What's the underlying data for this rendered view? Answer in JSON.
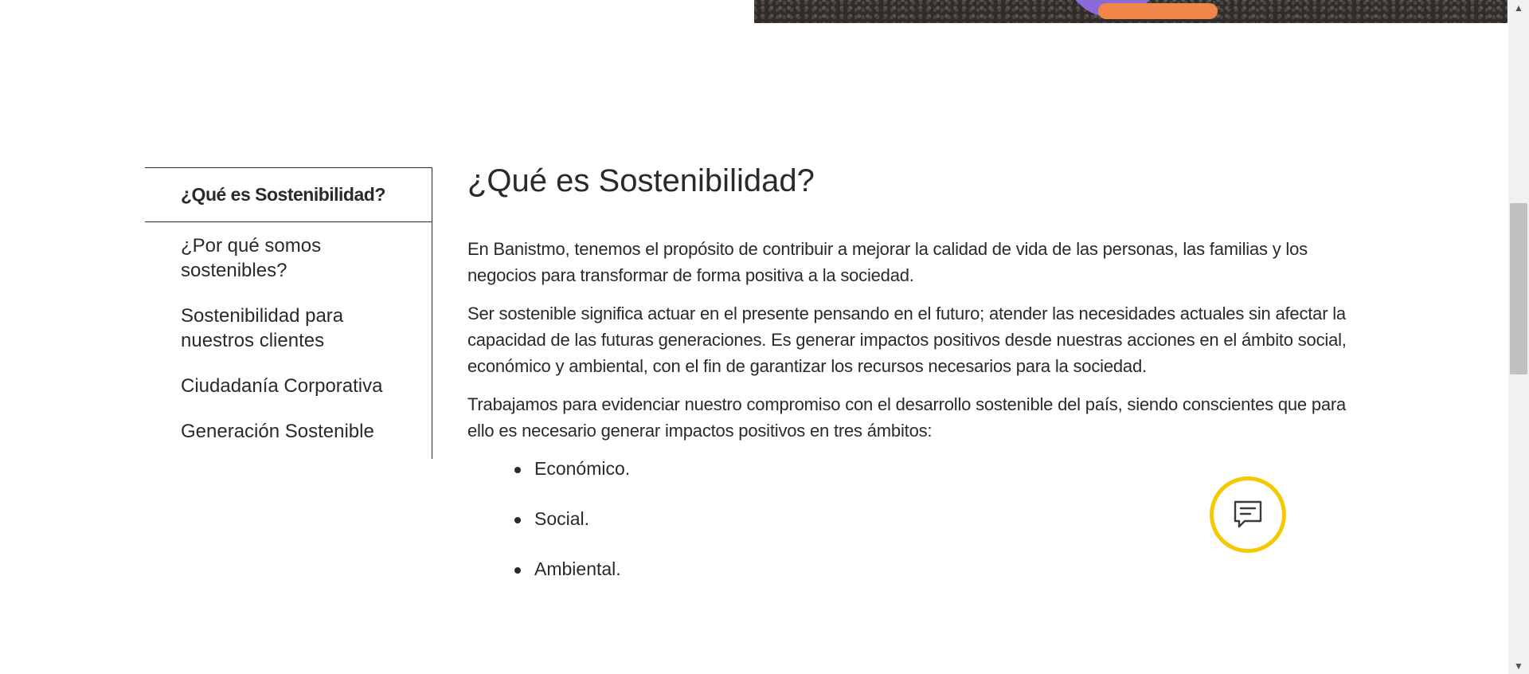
{
  "sidebar": {
    "items": [
      {
        "label": "¿Qué es Sostenibilidad?"
      },
      {
        "label": "¿Por qué somos sostenibles?"
      },
      {
        "label": "Sostenibilidad para nuestros clientes"
      },
      {
        "label": "Ciudadanía Corporativa"
      },
      {
        "label": "Generación Sostenible"
      }
    ]
  },
  "main": {
    "title": "¿Qué es Sostenibilidad?",
    "paragraphs": [
      "En Banistmo, tenemos el propósito de contribuir a mejorar la calidad de vida de las personas, las familias y los negocios para transformar de forma positiva a la sociedad.",
      "Ser sostenible significa actuar en el presente pensando en el futuro; atender las necesidades actuales sin afectar la capacidad de las futuras generaciones. Es generar impactos positivos desde nuestras acciones en el ámbito social, económico y ambiental, con el fin de garantizar los recursos necesarios para la sociedad.",
      "Trabajamos para evidenciar nuestro compromiso con el desarrollo sostenible del país, siendo conscientes que para ello es necesario generar impactos positivos en tres ámbitos:"
    ],
    "list": [
      "Económico.",
      "Social.",
      "Ambiental."
    ]
  },
  "chat": {
    "icon": "chat-bubble-icon"
  },
  "colors": {
    "accent": "#f5c800",
    "text": "#2a2a2a"
  }
}
